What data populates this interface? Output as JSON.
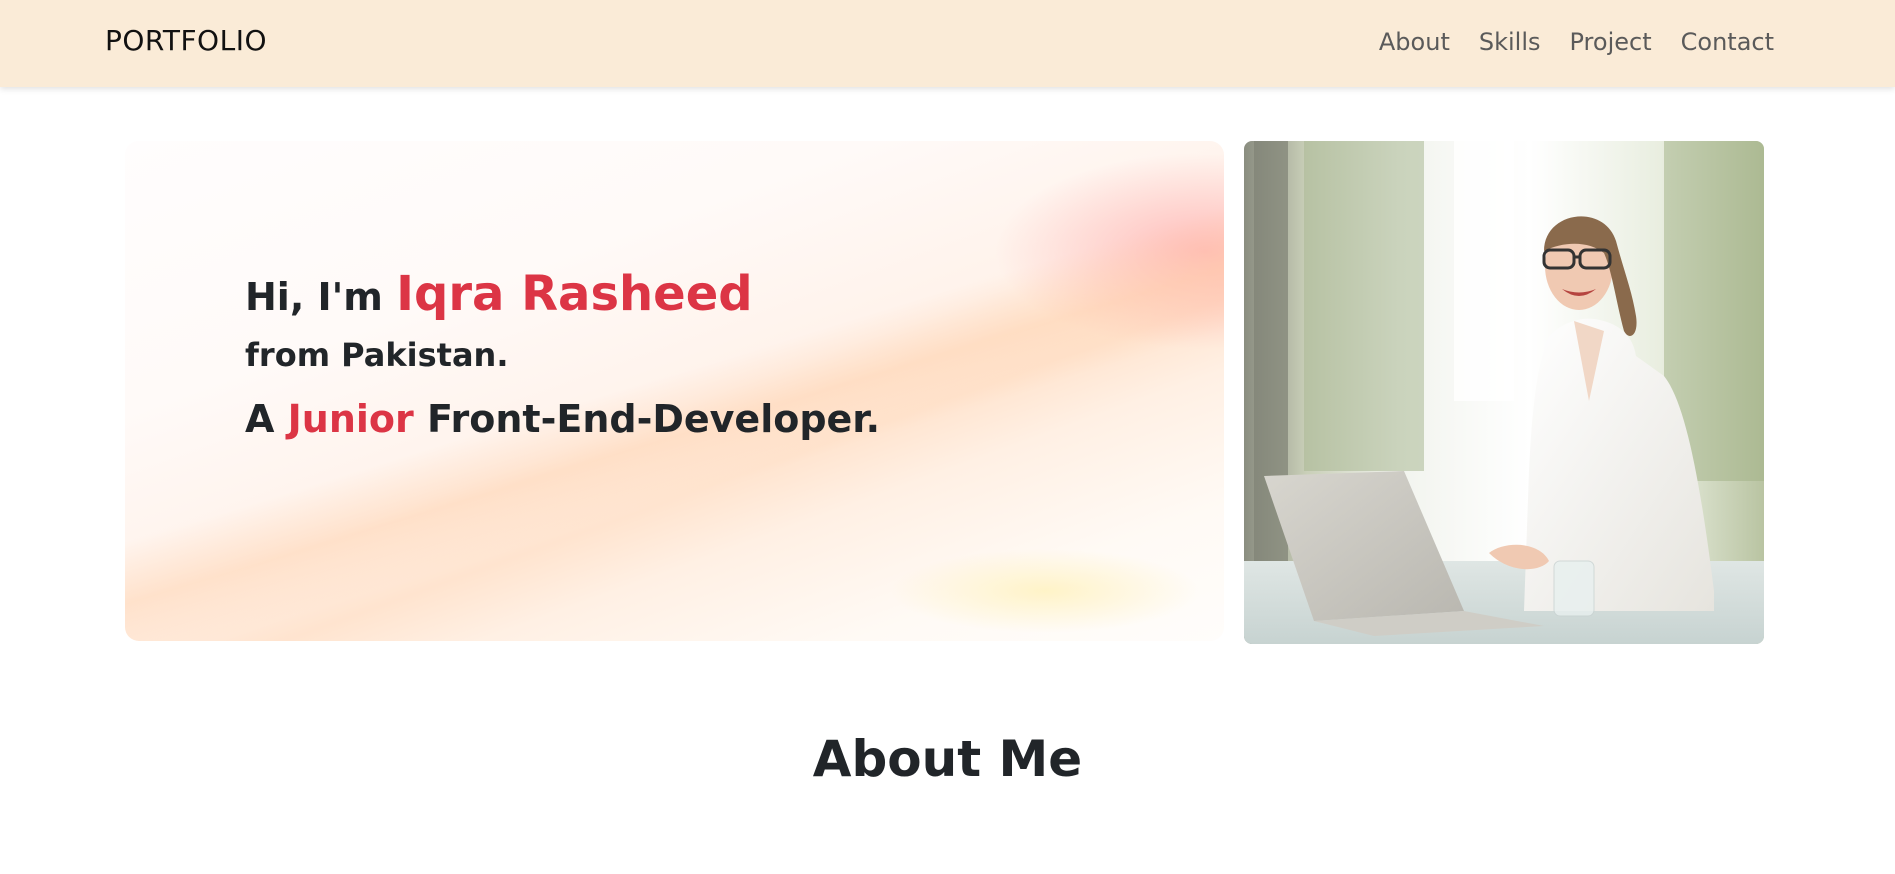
{
  "navbar": {
    "brand": "PORTFOLIO",
    "links": [
      "About",
      "Skills",
      "Project",
      "Contact"
    ],
    "background": "#faebd7"
  },
  "hero": {
    "greeting": "Hi, I'm ",
    "name": "Iqra Rasheed",
    "origin": "from Pakistan.",
    "role_prefix": "A ",
    "role_highlight": "Junior",
    "role_suffix": " Front-End-Developer.",
    "accent_color": "#dc3545"
  },
  "photo": {
    "icon": "photo-woman-laptop"
  },
  "about": {
    "title": "About Me"
  }
}
